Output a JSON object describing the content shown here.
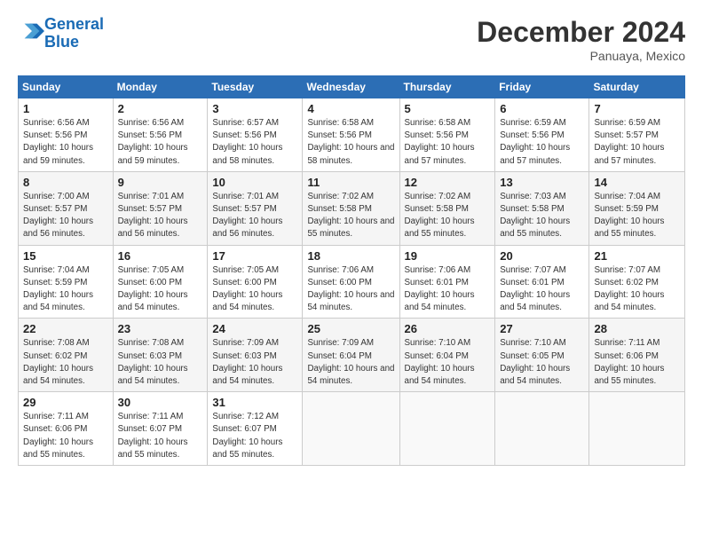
{
  "logo": {
    "text_general": "General",
    "text_blue": "Blue"
  },
  "header": {
    "month": "December 2024",
    "location": "Panuaya, Mexico"
  },
  "weekdays": [
    "Sunday",
    "Monday",
    "Tuesday",
    "Wednesday",
    "Thursday",
    "Friday",
    "Saturday"
  ],
  "weeks": [
    [
      {
        "day": "1",
        "sunrise": "6:56 AM",
        "sunset": "5:56 PM",
        "daylight": "10 hours and 59 minutes."
      },
      {
        "day": "2",
        "sunrise": "6:56 AM",
        "sunset": "5:56 PM",
        "daylight": "10 hours and 59 minutes."
      },
      {
        "day": "3",
        "sunrise": "6:57 AM",
        "sunset": "5:56 PM",
        "daylight": "10 hours and 58 minutes."
      },
      {
        "day": "4",
        "sunrise": "6:58 AM",
        "sunset": "5:56 PM",
        "daylight": "10 hours and 58 minutes."
      },
      {
        "day": "5",
        "sunrise": "6:58 AM",
        "sunset": "5:56 PM",
        "daylight": "10 hours and 57 minutes."
      },
      {
        "day": "6",
        "sunrise": "6:59 AM",
        "sunset": "5:56 PM",
        "daylight": "10 hours and 57 minutes."
      },
      {
        "day": "7",
        "sunrise": "6:59 AM",
        "sunset": "5:57 PM",
        "daylight": "10 hours and 57 minutes."
      }
    ],
    [
      {
        "day": "8",
        "sunrise": "7:00 AM",
        "sunset": "5:57 PM",
        "daylight": "10 hours and 56 minutes."
      },
      {
        "day": "9",
        "sunrise": "7:01 AM",
        "sunset": "5:57 PM",
        "daylight": "10 hours and 56 minutes."
      },
      {
        "day": "10",
        "sunrise": "7:01 AM",
        "sunset": "5:57 PM",
        "daylight": "10 hours and 56 minutes."
      },
      {
        "day": "11",
        "sunrise": "7:02 AM",
        "sunset": "5:58 PM",
        "daylight": "10 hours and 55 minutes."
      },
      {
        "day": "12",
        "sunrise": "7:02 AM",
        "sunset": "5:58 PM",
        "daylight": "10 hours and 55 minutes."
      },
      {
        "day": "13",
        "sunrise": "7:03 AM",
        "sunset": "5:58 PM",
        "daylight": "10 hours and 55 minutes."
      },
      {
        "day": "14",
        "sunrise": "7:04 AM",
        "sunset": "5:59 PM",
        "daylight": "10 hours and 55 minutes."
      }
    ],
    [
      {
        "day": "15",
        "sunrise": "7:04 AM",
        "sunset": "5:59 PM",
        "daylight": "10 hours and 54 minutes."
      },
      {
        "day": "16",
        "sunrise": "7:05 AM",
        "sunset": "6:00 PM",
        "daylight": "10 hours and 54 minutes."
      },
      {
        "day": "17",
        "sunrise": "7:05 AM",
        "sunset": "6:00 PM",
        "daylight": "10 hours and 54 minutes."
      },
      {
        "day": "18",
        "sunrise": "7:06 AM",
        "sunset": "6:00 PM",
        "daylight": "10 hours and 54 minutes."
      },
      {
        "day": "19",
        "sunrise": "7:06 AM",
        "sunset": "6:01 PM",
        "daylight": "10 hours and 54 minutes."
      },
      {
        "day": "20",
        "sunrise": "7:07 AM",
        "sunset": "6:01 PM",
        "daylight": "10 hours and 54 minutes."
      },
      {
        "day": "21",
        "sunrise": "7:07 AM",
        "sunset": "6:02 PM",
        "daylight": "10 hours and 54 minutes."
      }
    ],
    [
      {
        "day": "22",
        "sunrise": "7:08 AM",
        "sunset": "6:02 PM",
        "daylight": "10 hours and 54 minutes."
      },
      {
        "day": "23",
        "sunrise": "7:08 AM",
        "sunset": "6:03 PM",
        "daylight": "10 hours and 54 minutes."
      },
      {
        "day": "24",
        "sunrise": "7:09 AM",
        "sunset": "6:03 PM",
        "daylight": "10 hours and 54 minutes."
      },
      {
        "day": "25",
        "sunrise": "7:09 AM",
        "sunset": "6:04 PM",
        "daylight": "10 hours and 54 minutes."
      },
      {
        "day": "26",
        "sunrise": "7:10 AM",
        "sunset": "6:04 PM",
        "daylight": "10 hours and 54 minutes."
      },
      {
        "day": "27",
        "sunrise": "7:10 AM",
        "sunset": "6:05 PM",
        "daylight": "10 hours and 54 minutes."
      },
      {
        "day": "28",
        "sunrise": "7:11 AM",
        "sunset": "6:06 PM",
        "daylight": "10 hours and 55 minutes."
      }
    ],
    [
      {
        "day": "29",
        "sunrise": "7:11 AM",
        "sunset": "6:06 PM",
        "daylight": "10 hours and 55 minutes."
      },
      {
        "day": "30",
        "sunrise": "7:11 AM",
        "sunset": "6:07 PM",
        "daylight": "10 hours and 55 minutes."
      },
      {
        "day": "31",
        "sunrise": "7:12 AM",
        "sunset": "6:07 PM",
        "daylight": "10 hours and 55 minutes."
      },
      null,
      null,
      null,
      null
    ]
  ]
}
